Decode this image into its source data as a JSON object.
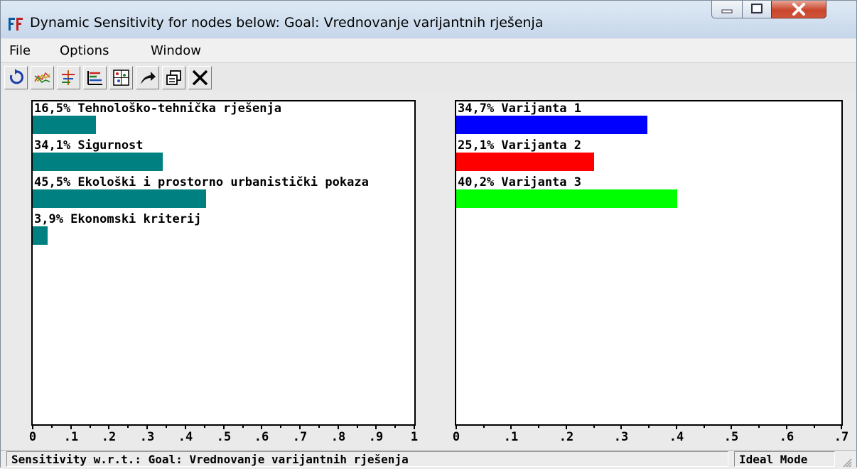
{
  "window": {
    "title": "Dynamic Sensitivity for nodes below: Goal: Vrednovanje varijantnih rješenja"
  },
  "menu": [
    "File",
    "Options",
    "Window"
  ],
  "toolbar": [
    "refresh-icon",
    "dynamic-graph-icon",
    "performance-graph-icon",
    "gradient-graph-icon",
    "two-dimensional-graph-icon",
    "difference-graph-icon",
    "copy-icon",
    "close-icon"
  ],
  "colors": {
    "criteria_bar": "#008080",
    "alt1": "#0000ff",
    "alt2": "#ff0000",
    "alt3": "#00ff00"
  },
  "chart_data": [
    {
      "type": "bar",
      "orientation": "horizontal",
      "labels": [
        "16,5% Tehnološko-tehnička rješenja",
        "34,1% Sigurnost",
        "45,5% Ekološki i prostorno urbanistički pokaza",
        "3,9% Ekonomski kriterij"
      ],
      "values": [
        0.165,
        0.341,
        0.455,
        0.039
      ],
      "xlim": [
        0,
        1
      ],
      "ticks": [
        "0",
        ".1",
        ".2",
        ".3",
        ".4",
        ".5",
        ".6",
        ".7",
        ".8",
        ".9",
        "1"
      ]
    },
    {
      "type": "bar",
      "orientation": "horizontal",
      "labels": [
        "34,7% Varijanta 1",
        "25,1% Varijanta 2",
        "40,2% Varijanta 3"
      ],
      "values": [
        0.347,
        0.251,
        0.402
      ],
      "xlim": [
        0,
        0.7
      ],
      "ticks": [
        "0",
        ".1",
        ".2",
        ".3",
        ".4",
        ".5",
        ".6",
        ".7"
      ]
    }
  ],
  "status": {
    "text": "Sensitivity w.r.t.: Goal: Vrednovanje varijantnih rješenja",
    "mode": "Ideal Mode"
  }
}
